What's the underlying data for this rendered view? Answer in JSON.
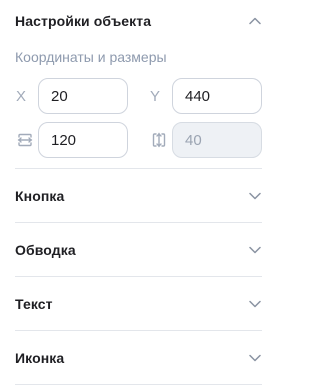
{
  "object_settings": {
    "title": "Настройки объекта",
    "expanded": true,
    "subtitle": "Координаты и размеры",
    "fields": {
      "x": {
        "label": "X",
        "value": "20"
      },
      "y": {
        "label": "Y",
        "value": "440"
      },
      "width": {
        "icon": "width-resize-icon",
        "value": "120"
      },
      "height": {
        "icon": "height-resize-icon",
        "value": "40",
        "disabled": true
      }
    }
  },
  "sections": [
    {
      "title": "Кнопка",
      "expanded": false
    },
    {
      "title": "Обводка",
      "expanded": false
    },
    {
      "title": "Текст",
      "expanded": false
    },
    {
      "title": "Иконка",
      "expanded": false
    }
  ],
  "colors": {
    "text": "#1f1f23",
    "muted": "#8e9aae",
    "border": "#cfd4dd",
    "divider": "#e3e6eb",
    "disabled_bg": "#eef1f5"
  }
}
